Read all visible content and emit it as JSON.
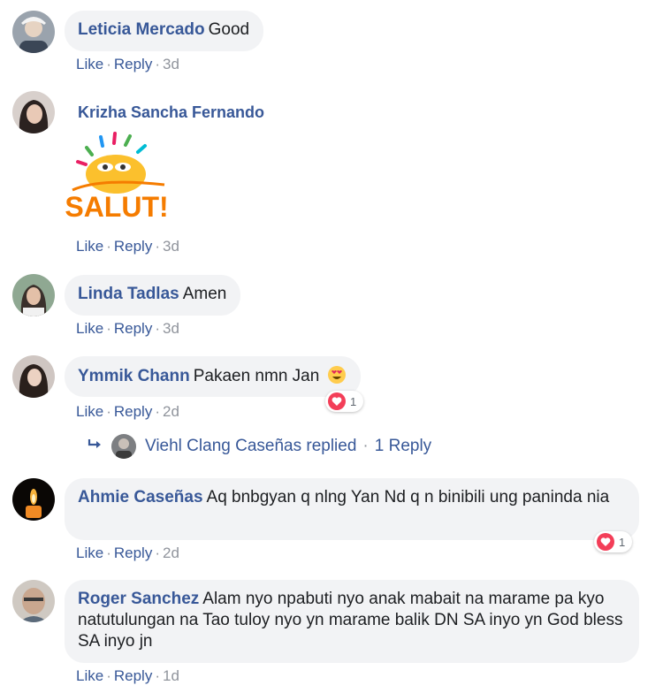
{
  "actions": {
    "like": "Like",
    "reply": "Reply",
    "separator": "·"
  },
  "comments": [
    {
      "author": "Leticia Mercado",
      "text": "Good",
      "time": "3d"
    },
    {
      "author": "Krizha Sancha Fernando",
      "sticker_text": "SALUT!",
      "time": "3d"
    },
    {
      "author": "Linda Tadlas",
      "text": "Amen",
      "time": "3d"
    },
    {
      "author": "Ymmik Chann",
      "text": "Pakaen nmn Jan",
      "emoji": "😍",
      "time": "2d",
      "reaction": {
        "type": "love",
        "count": "1"
      }
    },
    {
      "author": "Ahmie Caseñas",
      "text": "Aq bnbgyan q nlng Yan Nd q n binibili ung paninda nia",
      "time": "2d",
      "reaction": {
        "type": "love",
        "count": "1"
      }
    },
    {
      "author": "Roger Sanchez",
      "text": "Alam nyo npabuti nyo anak mabait na marame pa kyo natutulungan na Tao tuloy nyo yn marame balik DN SA inyo yn God bless SA inyo jn",
      "time": "1d"
    }
  ],
  "reply_summary": {
    "text": "Viehl Clang Caseñas replied",
    "count_label": "1 Reply"
  },
  "colors": {
    "link": "#385898",
    "bubble": "#f2f3f5",
    "meta": "#90949c",
    "love": "#f33e58"
  }
}
